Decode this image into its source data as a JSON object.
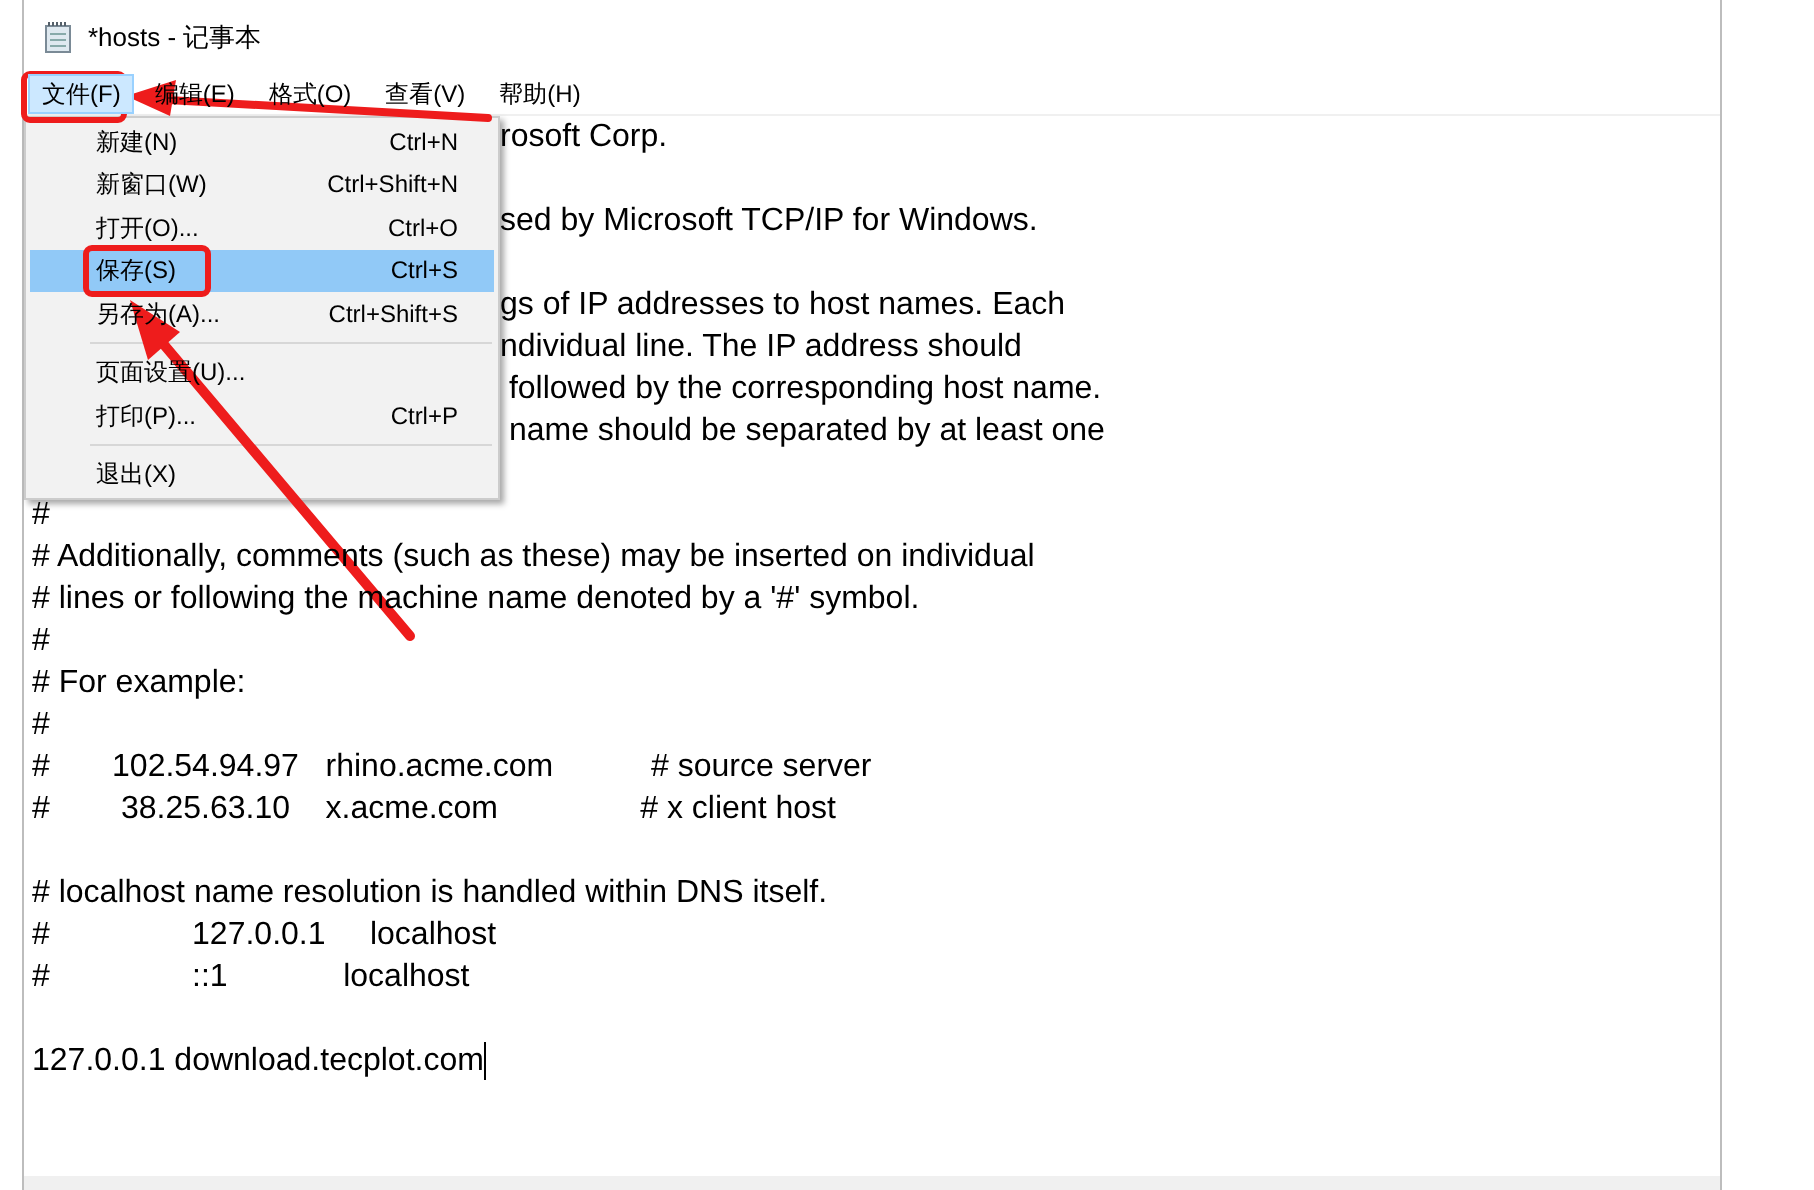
{
  "window": {
    "title": "*hosts - 记事本"
  },
  "menu_bar": [
    {
      "label": "文件(F)",
      "selected": true
    },
    {
      "label": "编辑(E)",
      "selected": false
    },
    {
      "label": "格式(O)",
      "selected": false
    },
    {
      "label": "查看(V)",
      "selected": false
    },
    {
      "label": "帮助(H)",
      "selected": false
    }
  ],
  "file_menu": {
    "items": [
      {
        "kind": "item",
        "label": "新建(N)",
        "shortcut": "Ctrl+N",
        "selected": false
      },
      {
        "kind": "item",
        "label": "新窗口(W)",
        "shortcut": "Ctrl+Shift+N",
        "selected": false
      },
      {
        "kind": "item",
        "label": "打开(O)...",
        "shortcut": "Ctrl+O",
        "selected": false
      },
      {
        "kind": "item",
        "label": "保存(S)",
        "shortcut": "Ctrl+S",
        "selected": true
      },
      {
        "kind": "item",
        "label": "另存为(A)...",
        "shortcut": "Ctrl+Shift+S",
        "selected": false
      },
      {
        "kind": "separator"
      },
      {
        "kind": "item",
        "label": "页面设置(U)...",
        "selected": false
      },
      {
        "kind": "item",
        "label": "打印(P)...",
        "shortcut": "Ctrl+P",
        "selected": false
      },
      {
        "kind": "separator"
      },
      {
        "kind": "item",
        "label": "退出(X)",
        "selected": false
      }
    ]
  },
  "editor": {
    "lines": [
      {
        "kind": "partial",
        "text": "rosoft Corp."
      },
      {
        "kind": "blank"
      },
      {
        "kind": "partial",
        "text": "sed by Microsoft TCP/IP for Windows."
      },
      {
        "kind": "blank"
      },
      {
        "kind": "partial",
        "text": "gs of IP addresses to host names. Each"
      },
      {
        "kind": "partial",
        "text": "ndividual line. The IP address should"
      },
      {
        "kind": "partial",
        "text": " followed by the corresponding host name."
      },
      {
        "kind": "partial",
        "text": " name should be separated by at least one"
      },
      {
        "kind": "blank"
      },
      {
        "kind": "text",
        "text": "#"
      },
      {
        "kind": "text",
        "text": "# Additionally, comments (such as these) may be inserted on individual"
      },
      {
        "kind": "text",
        "text": "# lines or following the machine name denoted by a '#' symbol."
      },
      {
        "kind": "text",
        "text": "#"
      },
      {
        "kind": "text",
        "text": "# For example:"
      },
      {
        "kind": "text",
        "text": "#"
      },
      {
        "kind": "text",
        "text": "#       102.54.94.97   rhino.acme.com           # source server"
      },
      {
        "kind": "text",
        "text": "#        38.25.63.10    x.acme.com                # x client host"
      },
      {
        "kind": "blank"
      },
      {
        "kind": "text",
        "text": "# localhost name resolution is handled within DNS itself."
      },
      {
        "kind": "text",
        "text": "#                127.0.0.1     localhost"
      },
      {
        "kind": "text",
        "text": "#                ::1             localhost"
      },
      {
        "kind": "blank"
      },
      {
        "kind": "caret",
        "text": "127.0.0.1 download.tecplot.com"
      }
    ]
  }
}
